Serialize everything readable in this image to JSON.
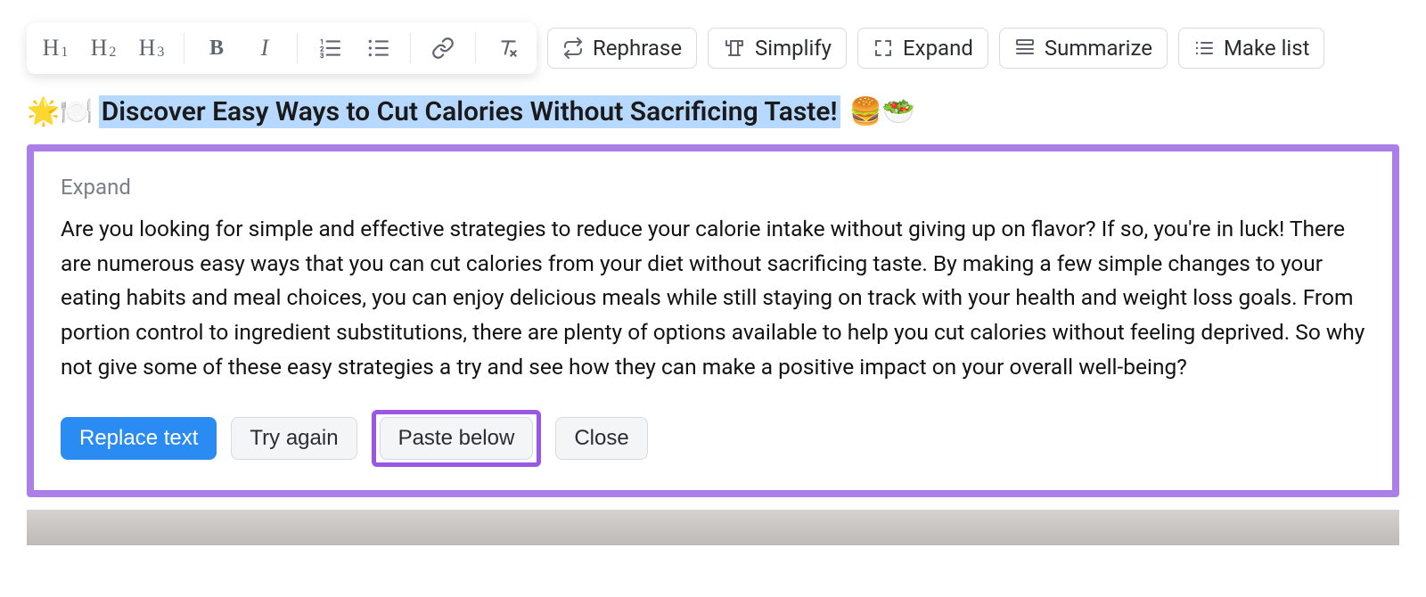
{
  "toolbar": {
    "headings": [
      "H1",
      "H2",
      "H3"
    ],
    "styles": {
      "bold": "B",
      "italic": "I"
    },
    "ai": {
      "rephrase": "Rephrase",
      "simplify": "Simplify",
      "expand": "Expand",
      "summarize": "Summarize",
      "make_list": "Make list"
    }
  },
  "headline": {
    "emoji_left": "🌟🍽️",
    "text": "Discover Easy Ways to Cut Calories Without Sacrificing Taste!",
    "emoji_right": "🍔🥗"
  },
  "panel": {
    "title": "Expand",
    "body": "Are you looking for simple and effective strategies to reduce your calorie intake without giving up on flavor? If so, you're in luck! There are numerous easy ways that you can cut calories from your diet without sacrificing taste. By making a few simple changes to your eating habits and meal choices, you can enjoy delicious meals while still staying on track with your health and weight loss goals. From portion control to ingredient substitutions, there are plenty of options available to help you cut calories without feeling deprived. So why not give some of these easy strategies a try and see how they can make a positive impact on your overall well-being?",
    "actions": {
      "replace": "Replace text",
      "try_again": "Try again",
      "paste_below": "Paste below",
      "close": "Close"
    }
  }
}
